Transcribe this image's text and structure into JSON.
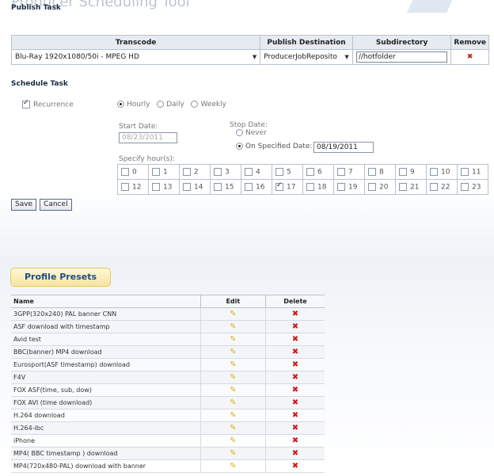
{
  "header": {
    "page_heading": "Producer Scheduling Tool"
  },
  "publish_task": {
    "title": "Publish Task",
    "columns": [
      "Transcode",
      "Publish Destination",
      "Subdirectory",
      "Remove"
    ],
    "row": {
      "transcode": "Blu-Ray 1920x1080/50i - MPEG HD",
      "destination": "ProducerJobReposito",
      "subdirectory": "//hotfolder",
      "remove_icon": "remove-x-icon"
    }
  },
  "schedule_task": {
    "title": "Schedule Task",
    "recurrence_label": "Recurrence",
    "recurrence_checked": true,
    "frequency_options": [
      "Hourly",
      "Daily",
      "Weekly"
    ],
    "frequency_selected": "Hourly",
    "start_date_label": "Start Date:",
    "start_date_value": "08/23/2011",
    "stop_date_label": "Stop Date:",
    "never_label": "Never",
    "on_date_label": "On Specified Date:",
    "stop_date_value": "08/19/2011",
    "stop_selected": "on_date",
    "specify_hours_label": "Specify hour(s):",
    "hours_row1": [
      "0",
      "1",
      "2",
      "3",
      "4",
      "5",
      "6",
      "7",
      "8",
      "9",
      "10",
      "11"
    ],
    "hours_row2": [
      "12",
      "13",
      "14",
      "15",
      "16",
      "17",
      "18",
      "19",
      "20",
      "21",
      "22",
      "23"
    ],
    "hours_checked": [
      "17"
    ]
  },
  "actions": {
    "save": "Save",
    "cancel": "Cancel"
  },
  "profile_presets": {
    "tab_label": "Profile Presets",
    "columns": [
      "Name",
      "Edit",
      "Delete"
    ],
    "rows": [
      "3GPP(320x240) PAL banner CNN",
      "ASF download with timestamp",
      "Avid test",
      "BBC(banner) MP4 download",
      "Eurosport(ASF timestamp) download",
      "F4V",
      "FOX ASF(time, sub, dow)",
      "FOX AVI (time download)",
      "H.264 download",
      "H.264-ibc",
      "iPhone",
      "MP4( BBC timestamp ) download",
      "MP4(720x480-PAL) download with banner"
    ]
  },
  "colors": {
    "remove_red": "#d01818",
    "edit_yellow": "#e0b010",
    "tab_gold": "#f7e3a1",
    "link_blue": "#1c4c8a"
  }
}
